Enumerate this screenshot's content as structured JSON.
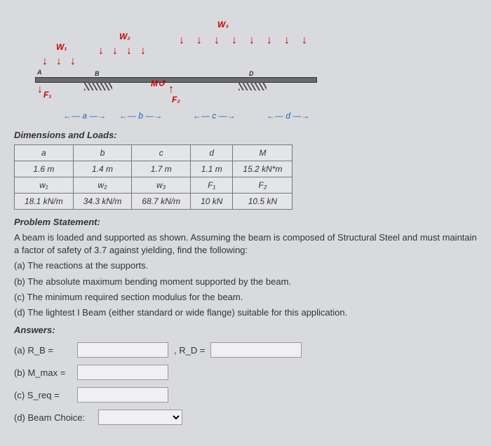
{
  "diagram": {
    "w1": "W₁",
    "w2": "W₂",
    "w3": "W₃",
    "F1": "F₁",
    "F2": "F₂",
    "M": "M",
    "a": "a",
    "b": "b",
    "c": "c",
    "d": "d",
    "A": "A",
    "B": "B",
    "D": "D"
  },
  "headings": {
    "dimLoads": "Dimensions and Loads:",
    "problemStatement": "Problem Statement:",
    "answers": "Answers:"
  },
  "table1": {
    "h": {
      "a": "a",
      "b": "b",
      "c": "c",
      "d": "d",
      "M": "M"
    },
    "v": {
      "a": "1.6 m",
      "b": "1.4 m",
      "c": "1.7 m",
      "d": "1.1 m",
      "M": "15.2 kN*m"
    }
  },
  "table2": {
    "h": {
      "w1": "w₁",
      "w2": "w₂",
      "w3": "w₃",
      "F1": "F₁",
      "F2": "F₂"
    },
    "v": {
      "w1": "18.1 kN/m",
      "w2": "34.3 kN/m",
      "w3": "68.7 kN/m",
      "F1": "10 kN",
      "F2": "10.5 kN"
    }
  },
  "problem_text": "A beam is loaded and supported as shown. Assuming the beam is composed of Structural Steel and must maintain a factor of safety of 3.7 against yielding, find the following:",
  "parts": {
    "a": "(a) The reactions at the supports.",
    "b": "(b) The absolute maximum bending moment supported by the beam.",
    "c": "(c) The minimum required section modulus for the beam.",
    "d": "(d) The lightest I Beam (either standard or wide flange) suitable for this application."
  },
  "ans_labels": {
    "a1": "(a) R_B =",
    "a2": ", R_D =",
    "b": "(b) M_max =",
    "c": "(c) S_req =",
    "d": "(d) Beam Choice:"
  }
}
